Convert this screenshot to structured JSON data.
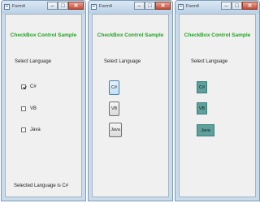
{
  "windows": [
    {
      "title": "Form4",
      "form_title": "CheckBox Control  Sample",
      "prompt": "Select Language",
      "options": [
        {
          "label": "C#",
          "checked": true
        },
        {
          "label": "VB",
          "checked": false
        },
        {
          "label": "Java",
          "checked": false
        }
      ],
      "result": "Selected Language is C#"
    },
    {
      "title": "Form4",
      "form_title": "CheckBox Control  Sample",
      "prompt": "Select Language",
      "options": [
        {
          "label": "C#",
          "pressed": true
        },
        {
          "label": "VB",
          "pressed": false
        },
        {
          "label": "Java",
          "pressed": false
        }
      ]
    },
    {
      "title": "Form4",
      "form_title": "CheckBox Control  Sample",
      "prompt": "Select Language",
      "options": [
        {
          "label": "C#"
        },
        {
          "label": "VB"
        },
        {
          "label": "Java"
        }
      ]
    }
  ],
  "caption_buttons": {
    "minimize": "–",
    "maximize": "□",
    "close": "✕"
  }
}
